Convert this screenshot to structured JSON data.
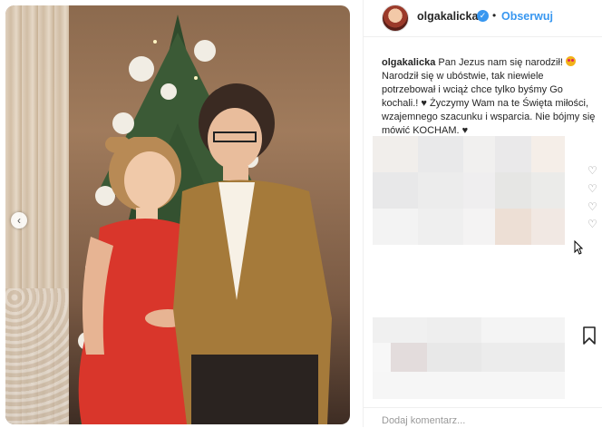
{
  "post": {
    "username": "olgakalicka",
    "verified_symbol": "✓",
    "separator": "•",
    "follow_label": "Obserwuj",
    "caption_user": "olgakalicka",
    "caption_text_1": " Pan Jezus nam się narodził! ",
    "caption_text_2": " Narodził się w ubóstwie, tak niewiele potrzebował i wciąż chce tylko byśmy Go kochali.! ",
    "caption_text_3": "♥",
    "caption_text_4": " Życzymy Wam na te Święta miłości, wzajemnego szacunku i wsparcia. Nie bójmy się mówić KOCHAM. ",
    "caption_text_5": "♥",
    "heart_icon": "♡",
    "comment_placeholder": "Dodaj komentarz...",
    "nav_prev_icon": "‹"
  },
  "colors": {
    "accent": "#3897f0",
    "text": "#262626",
    "muted": "#999999"
  },
  "icons": [
    "verified-icon",
    "heart-icon",
    "bookmark-icon",
    "cursor-icon",
    "chevron-left-icon"
  ]
}
